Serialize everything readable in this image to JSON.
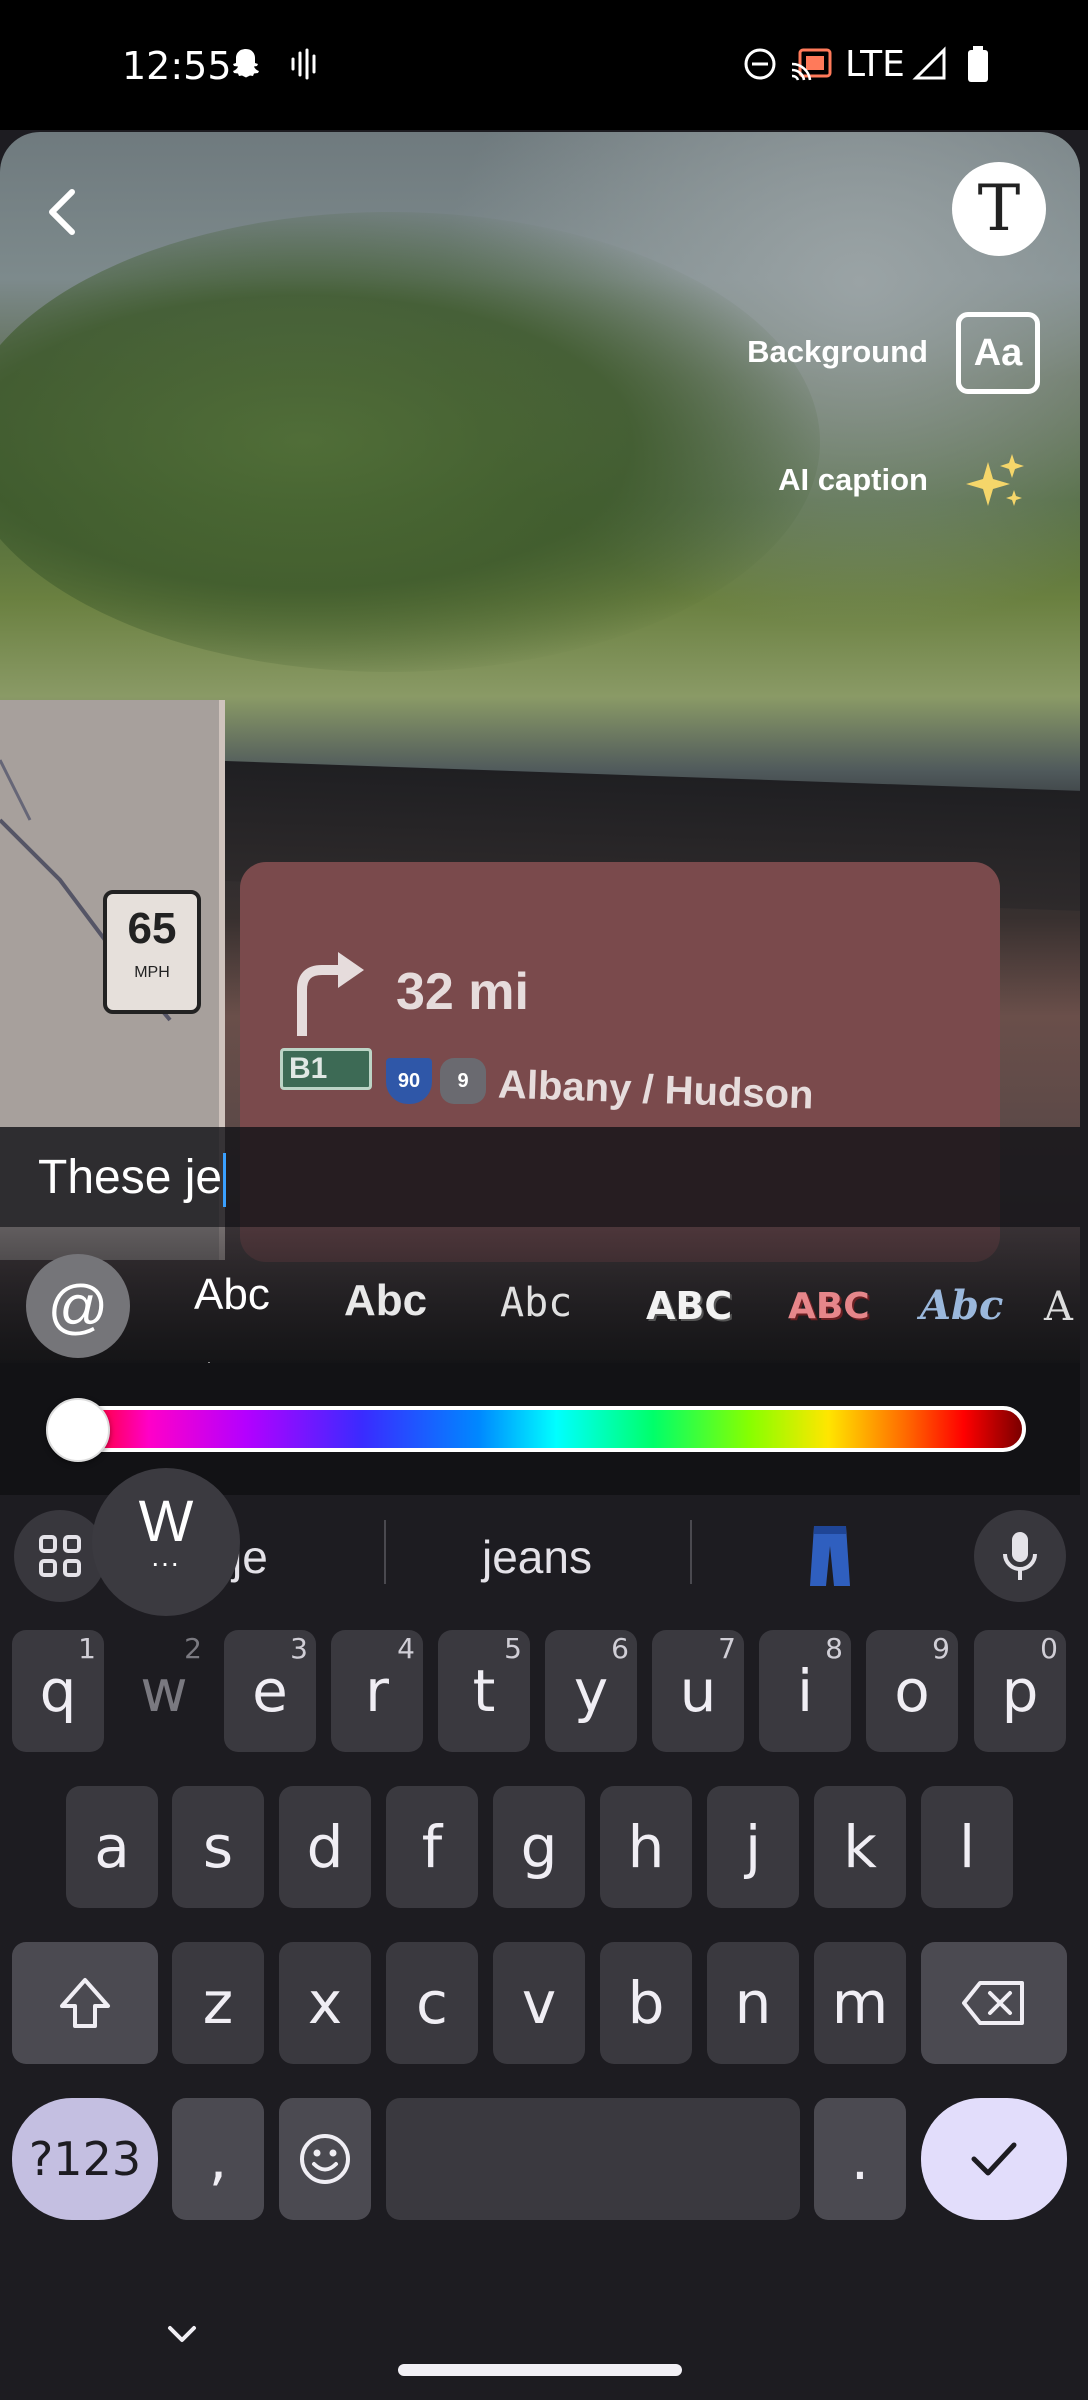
{
  "status_bar": {
    "time": "12:55",
    "network": "LTE",
    "icons": [
      "snapchat-ghost-icon",
      "voice-icon",
      "do-not-disturb-icon",
      "cast-icon",
      "signal-icon",
      "battery-icon"
    ]
  },
  "photo_overlay": {
    "speed_limit": "65",
    "speed_unit": "MPH",
    "distance": "32 mi",
    "exit": "B1",
    "shield_90": "90",
    "shield_9": "9",
    "road": "Albany / Hudson"
  },
  "tools": {
    "background_label": "Background",
    "background_icon_text": "Aa",
    "ai_caption_label": "AI caption",
    "text_tool_glyph": "T"
  },
  "caption": {
    "text": "These je"
  },
  "text_styles": {
    "mention_symbol": "@",
    "options": [
      "Abc",
      "Abc",
      "Abc",
      "ABC",
      "ABC",
      "Abc",
      "A"
    ],
    "selected_index": 0
  },
  "color_slider": {
    "selected_position": 0.0
  },
  "keyboard": {
    "popup_letter": "W",
    "popup_dots": "...",
    "suggestions": [
      "je",
      "jeans",
      "👖"
    ],
    "row1": [
      {
        "k": "q",
        "n": "1"
      },
      {
        "k": "w",
        "n": "2"
      },
      {
        "k": "e",
        "n": "3"
      },
      {
        "k": "r",
        "n": "4"
      },
      {
        "k": "t",
        "n": "5"
      },
      {
        "k": "y",
        "n": "6"
      },
      {
        "k": "u",
        "n": "7"
      },
      {
        "k": "i",
        "n": "8"
      },
      {
        "k": "o",
        "n": "9"
      },
      {
        "k": "p",
        "n": "0"
      }
    ],
    "row2": [
      "a",
      "s",
      "d",
      "f",
      "g",
      "h",
      "j",
      "k",
      "l"
    ],
    "row3": [
      "z",
      "x",
      "c",
      "v",
      "b",
      "n",
      "m"
    ],
    "symbols_label": "?123",
    "comma": ",",
    "period": "."
  },
  "colors": {
    "accent_done": "#e2ddfb",
    "key_bg": "#3a393f",
    "caret": "#3aa0ff"
  }
}
